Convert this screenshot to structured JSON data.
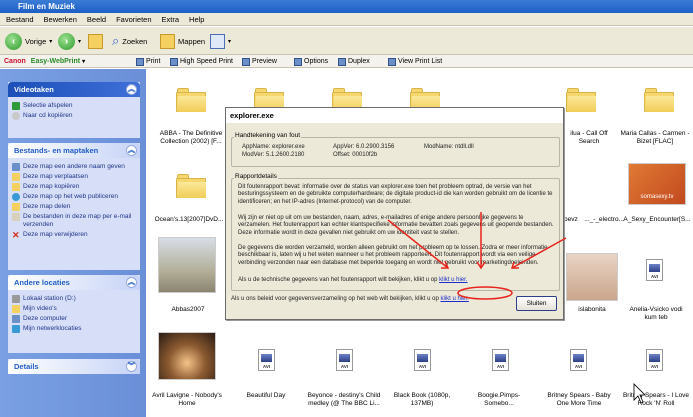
{
  "window": {
    "title": "Film en Muziek"
  },
  "menu": [
    "Bestand",
    "Bewerken",
    "Beeld",
    "Favorieten",
    "Extra",
    "Help"
  ],
  "toolbar": {
    "back": "Vorige",
    "search": "Zoeken",
    "folders": "Mappen"
  },
  "easywebprint": {
    "brand": "Canon",
    "product": "Easy-WebPrint",
    "print": "Print",
    "hsprint": "High Speed Print",
    "preview": "Preview",
    "options": "Options",
    "duplex": "Duplex",
    "viewlist": "View Print List"
  },
  "sidebar": {
    "video": {
      "title": "Videotaken",
      "items": [
        "Selectie afspelen",
        "Naar cd kopiëren"
      ]
    },
    "files": {
      "title": "Bestands- en maptaken",
      "items": [
        "Deze map een andere naam geven",
        "Deze map verplaatsen",
        "Deze map kopiëren",
        "Deze map op het web publiceren",
        "Deze map delen",
        "De bestanden in deze map per e-mail verzenden",
        "Deze map verwijderen"
      ]
    },
    "other": {
      "title": "Andere locaties",
      "items": [
        "Lokaal station (D:)",
        "Mijn video's",
        "Deze computer",
        "Mijn netwerklocaties"
      ]
    },
    "details": {
      "title": "Details"
    }
  },
  "files": {
    "r1": [
      "ABBA - The Definitive Collection (2002) [F...",
      "ilua - Call Off Search",
      "Maria Callas - Carmen - Bizet [FLAC]"
    ],
    "r2": [
      "Ocean's.13[2007]DvD...",
      "bevz",
      "..._-_electro...",
      "A_Sexy_Encounter[S..."
    ],
    "r3": [
      "Abbas2007",
      "islabonita",
      "Anelia-Vsicko vodi kum teb"
    ],
    "r4": [
      "Avril Lavigne - Nobody's Home",
      "Beautiful Day",
      "Beyonce - destiny's Child medley (@ The BBC Li...",
      "Black Book (1080p, 137MB)",
      "Boogie.Pimps-Somebo...",
      "Britney Spears - Baby One More Time",
      "Britney Spears - I Love Rock 'N' Roll"
    ],
    "avi": "AVI",
    "somasexy": "somasexy.tv"
  },
  "dialog": {
    "title": "explorer.exe",
    "sig_group": "Handtekening van fout",
    "appname_lbl": "AppName: explorer.exe",
    "modver_lbl": "ModVer: 5.1.2600.2180",
    "appver_lbl": "AppVer: 6.0.2900.3156",
    "offset_lbl": "Offset: 00010f2b",
    "modname_lbl": "ModName: ntdll.dll",
    "report_group": "Rapportdetails",
    "p1": "Dit foutenrapport bevat: informatie over de status van explorer.exe toen het probleem optrad, de versie van het besturingssysteem en de gebruikte computerhardware; de digitale product-id die kan worden gebruikt om de licentie te identificeren; en het IP-adres (Internet-protocol) van de computer.",
    "p2": "Wij zijn er niet op uit om uw bestanden, naam, adres, e-mailadres of enige andere persoonlijke gegevens te verzamelen. Het foutenrapport kan echter klantspecifieke informatie bevatten zoals gegevens uit geopende bestanden. Deze informatie wordt in deze gevallen niet gebruikt om uw identiteit vast te stellen.",
    "p3": "De gegevens die worden verzameld, worden alleen gebruikt om het probleem op te lossen. Zodra er meer informatie beschikbaar is, laten wij u het weten wanneer u het probleem rapporteert. Dit foutenrapport wordt via een veilige verbinding verzonden naar een database met beperkte toegang en wordt niet gebruikt voor marketingdoeleinden.",
    "line1": "Als u de technische gegevens van het foutenrapport wilt bekijken, klikt u op",
    "line2": "Als u ons beleid voor gegevensverzameling op het web wilt bekijken, klikt u op",
    "link": "klikt u hier.",
    "close": "Sluiten"
  },
  "colors": {
    "annotation": "#e8231c",
    "link": "#1b2ec9"
  }
}
